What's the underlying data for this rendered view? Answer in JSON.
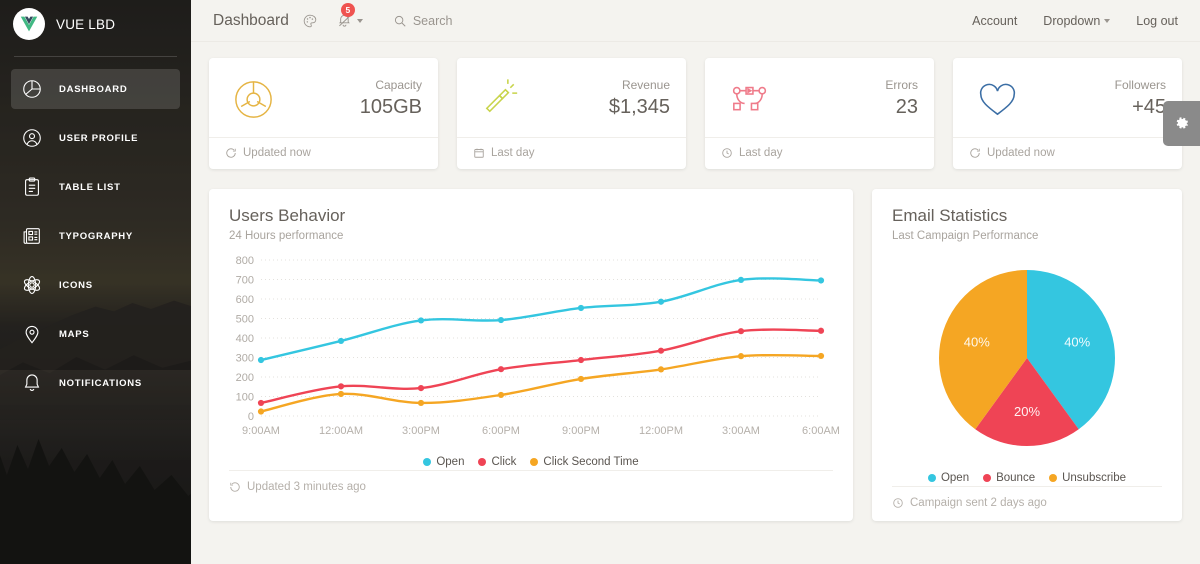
{
  "theme": {
    "accent_cyan": "#34c6e0",
    "accent_red": "#ef4455",
    "accent_orange": "#f5a623",
    "accent_yellow": "#e5b443",
    "accent_green": "#c8d44a",
    "accent_pink": "#ef7b8a",
    "accent_blue": "#3b6ea5",
    "sidebar_bg": "#2b2b2b",
    "page_bg": "#f4f3ef",
    "text_primary": "#66615b",
    "text_muted": "#9a958f",
    "badge_red": "#ef5350"
  },
  "sidebar": {
    "brand": {
      "title": "VUE LBD",
      "logo_icon": "vue-logo-icon"
    },
    "items": [
      {
        "label": "Dashboard",
        "icon": "pie-chart-icon",
        "active": true
      },
      {
        "label": "User Profile",
        "icon": "user-circle-icon",
        "active": false
      },
      {
        "label": "Table List",
        "icon": "clipboard-icon",
        "active": false
      },
      {
        "label": "Typography",
        "icon": "newspaper-icon",
        "active": false
      },
      {
        "label": "Icons",
        "icon": "atom-icon",
        "active": false
      },
      {
        "label": "Maps",
        "icon": "map-pin-icon",
        "active": false
      },
      {
        "label": "Notifications",
        "icon": "bell-icon",
        "active": false
      }
    ]
  },
  "topbar": {
    "title": "Dashboard",
    "icons": [
      {
        "name": "palette-icon",
        "badge": null
      },
      {
        "name": "bell-dropdown-icon",
        "badge": "5"
      }
    ],
    "search": {
      "label": "Search",
      "placeholder": "Search",
      "icon": "search-icon"
    },
    "right_links": [
      {
        "label": "Account",
        "caret": false
      },
      {
        "label": "Dropdown",
        "caret": true
      },
      {
        "label": "Log out",
        "caret": false
      }
    ]
  },
  "settings_tab": {
    "icon": "gear-icon",
    "label": "Settings"
  },
  "stats": [
    {
      "label": "Capacity",
      "value": "105GB",
      "icon": "donut-chart-icon",
      "icon_color": "#e5b443",
      "footer": "Updated now",
      "footer_icon": "refresh-icon"
    },
    {
      "label": "Revenue",
      "value": "$1,345",
      "icon": "flashlight-icon",
      "icon_color": "#c8d44a",
      "footer": "Last day",
      "footer_icon": "calendar-icon"
    },
    {
      "label": "Errors",
      "value": "23",
      "icon": "git-graph-icon",
      "icon_color": "#ef7b8a",
      "footer": "Last day",
      "footer_icon": "clock-icon"
    },
    {
      "label": "Followers",
      "value": "+45",
      "icon": "heart-icon",
      "icon_color": "#3b6ea5",
      "footer": "Updated now",
      "footer_icon": "refresh-icon"
    }
  ],
  "panels": {
    "users_behavior": {
      "title": "Users Behavior",
      "subtitle": "24 Hours performance",
      "footer": "Updated 3 minutes ago",
      "footer_icon": "history-icon",
      "legend": [
        {
          "label": "Open",
          "color": "#34c6e0"
        },
        {
          "label": "Click",
          "color": "#ef4455"
        },
        {
          "label": "Click Second Time",
          "color": "#f5a623"
        }
      ]
    },
    "email_statistics": {
      "title": "Email Statistics",
      "subtitle": "Last Campaign Performance",
      "footer": "Campaign sent 2 days ago",
      "footer_icon": "clock-icon",
      "legend": [
        {
          "label": "Open",
          "color": "#34c6e0"
        },
        {
          "label": "Bounce",
          "color": "#ef4455"
        },
        {
          "label": "Unsubscribe",
          "color": "#f5a623"
        }
      ]
    }
  },
  "chart_data": [
    {
      "id": "users-behavior-line",
      "type": "line",
      "title": "Users Behavior",
      "subtitle": "24 Hours performance",
      "xlabel": "",
      "ylabel": "",
      "grid": true,
      "legend_position": "bottom",
      "ylim": [
        0,
        800
      ],
      "yticks": [
        0,
        100,
        200,
        300,
        400,
        500,
        600,
        700,
        800
      ],
      "categories": [
        "9:00AM",
        "12:00AM",
        "3:00PM",
        "6:00PM",
        "9:00PM",
        "12:00PM",
        "3:00AM",
        "6:00AM"
      ],
      "series": [
        {
          "name": "Open",
          "color": "#34c6e0",
          "values": [
            287,
            385,
            490,
            492,
            554,
            586,
            698,
            695
          ]
        },
        {
          "name": "Click",
          "color": "#ef4455",
          "values": [
            67,
            152,
            143,
            240,
            287,
            335,
            435,
            437
          ]
        },
        {
          "name": "Click Second Time",
          "color": "#f5a623",
          "values": [
            23,
            113,
            67,
            108,
            190,
            239,
            307,
            308
          ]
        }
      ]
    },
    {
      "id": "email-statistics-pie",
      "type": "pie",
      "title": "Email Statistics",
      "subtitle": "Last Campaign Performance",
      "legend_position": "bottom",
      "labels": [
        "Open",
        "Bounce",
        "Unsubscribe"
      ],
      "values": [
        40,
        20,
        40
      ],
      "colors": [
        "#34c6e0",
        "#ef4455",
        "#f5a623"
      ],
      "data_labels": [
        "40%",
        "20%",
        "40%"
      ],
      "start_angle_deg": -90
    }
  ]
}
